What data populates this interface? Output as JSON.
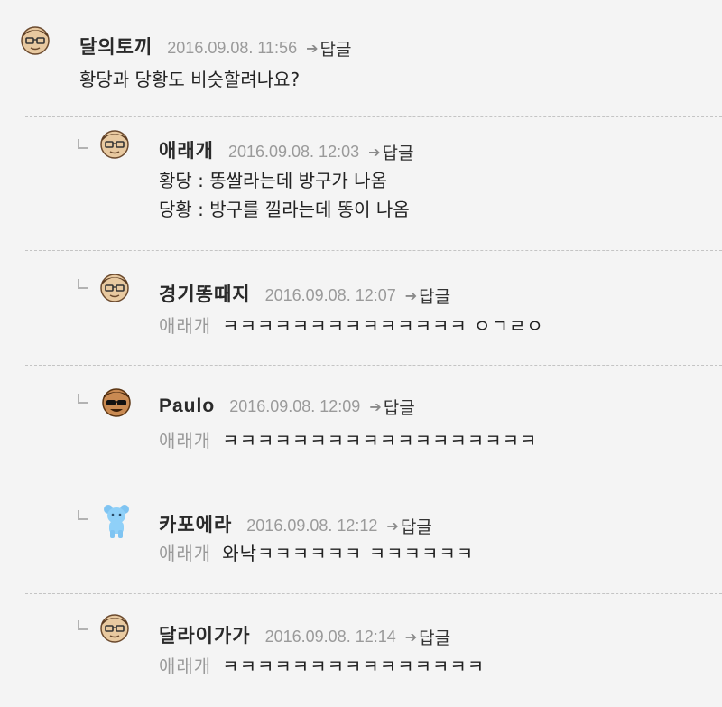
{
  "reply_label": "답글",
  "comments": [
    {
      "author": "달의토끼",
      "timestamp": "2016.09.08. 11:56",
      "lines": [
        "황당과 당황도 비슷할려나요?"
      ],
      "avatar_icon": "glasses-face-icon"
    },
    {
      "author": "애래개",
      "timestamp": "2016.09.08. 12:03",
      "lines": [
        "황당 : 똥쌀라는데 방구가 나옴",
        "당황 : 방구를 낄라는데 똥이 나옴"
      ],
      "avatar_icon": "glasses-face-icon"
    },
    {
      "author": "경기똥때지",
      "timestamp": "2016.09.08. 12:07",
      "mention": "애래개",
      "text": "ㅋㅋㅋㅋㅋㅋㅋㅋㅋㅋㅋㅋㅋㅋ ㅇㄱㄹㅇ",
      "avatar_icon": "glasses-face-icon"
    },
    {
      "author": "Paulo",
      "timestamp": "2016.09.08. 12:09",
      "mention": "애래개",
      "text": "ㅋㅋㅋㅋㅋㅋㅋㅋㅋㅋㅋㅋㅋㅋㅋㅋㅋㅋ",
      "avatar_icon": "sunglasses-face-icon"
    },
    {
      "author": "카포에라",
      "timestamp": "2016.09.08. 12:12",
      "mention": "애래개",
      "text": "와낙ㅋㅋㅋㅋㅋㅋ ㅋㅋㅋㅋㅋㅋ",
      "avatar_icon": "blue-bear-icon"
    },
    {
      "author": "달라이가가",
      "timestamp": "2016.09.08. 12:14",
      "mention": "애래개",
      "text": "ㅋㅋㅋㅋㅋㅋㅋㅋㅋㅋㅋㅋㅋㅋㅋ",
      "avatar_icon": "glasses-face-icon"
    }
  ]
}
